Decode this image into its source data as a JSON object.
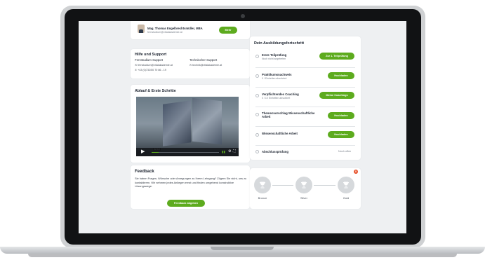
{
  "contact": {
    "name": "Mag. Thomas Engelbrechtsmüller, MBA",
    "email": "fernstudium@vitalakademie.at",
    "more_button": "Mehr"
  },
  "support": {
    "title": "Hilfe und Support",
    "col1_heading": "Fernstudium Support",
    "col1_email": "fernstudium@vitalakademie.at",
    "col1_phone": "+43 (0)732/50 70 86 - 19",
    "col2_heading": "Technischer Support",
    "col2_email": "technik@vitalakademie.at"
  },
  "video_card": {
    "title": "Ablauf & Erste Schritte",
    "time": "02:10",
    "progress": 0.1
  },
  "feedback": {
    "title": "Feedback",
    "text": "Sie haben Fragen, Wünsche oder Anregungen zu Ihrem Lehrgang? Zögern Sie nicht, uns zu kontaktieren. Wir nehmen jedes Anliegen ernst und finden umgehend konstruktive Lösungswege.",
    "button": "Feedback abgeben"
  },
  "progress": {
    "title": "Dein Ausbildungsfortschritt",
    "steps": [
      {
        "title": "Erste Teilprüfung",
        "sub": "Noch nicht angetreten",
        "action": "Zur 1. Teilprüfung"
      },
      {
        "title": "Praktikumsnachweis",
        "sub": "0 / Einheiten absolviert",
        "action": "Hochladen"
      },
      {
        "title": "Verpflichtendes Coaching",
        "sub": "0 / 10 Einheiten absolviert",
        "action": "Meine Coachings"
      },
      {
        "title": "Themenvorschlag Wissenschaftliche Arbeit",
        "sub": "",
        "action": "Hochladen"
      },
      {
        "title": "Wissenschaftliche Arbeit",
        "sub": "",
        "action": "Hochladen"
      },
      {
        "title": "Abschlussprüfung",
        "sub": "",
        "status": "Noch offen"
      }
    ]
  },
  "awards": {
    "badge_count": "0",
    "levels": [
      "Bronze",
      "Silver",
      "Gold"
    ]
  },
  "colors": {
    "accent": "#5dab1e",
    "badge": "#e8542e"
  }
}
